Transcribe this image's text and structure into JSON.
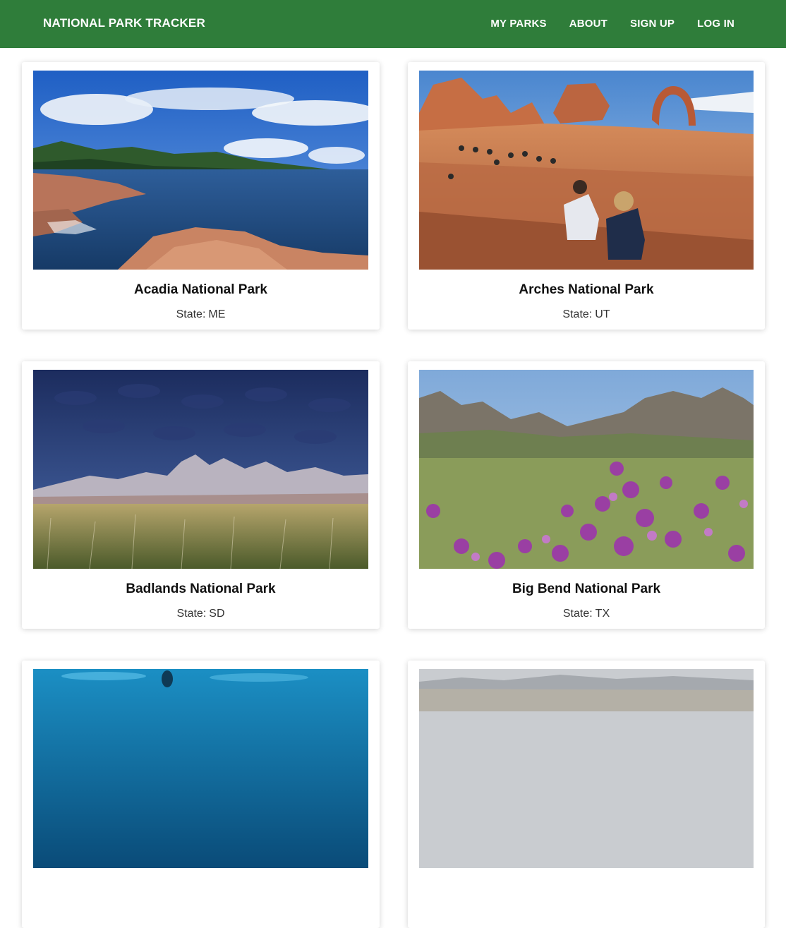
{
  "header": {
    "brand": "NATIONAL PARK TRACKER",
    "nav": [
      {
        "label": "MY PARKS"
      },
      {
        "label": "ABOUT"
      },
      {
        "label": "SIGN UP"
      },
      {
        "label": "LOG IN"
      }
    ]
  },
  "colors": {
    "nav_background": "#2f7d3a",
    "nav_text": "#ffffff"
  },
  "state_label": "State:",
  "parks": [
    {
      "name": "Acadia National Park",
      "state": "ME",
      "photo": "rocky-ocean-coast-photo"
    },
    {
      "name": "Arches National Park",
      "state": "UT",
      "photo": "desert-arch-hikers-photo"
    },
    {
      "name": "Badlands National Park",
      "state": "SD",
      "photo": "storm-badlands-grassland-photo"
    },
    {
      "name": "Big Bend National Park",
      "state": "TX",
      "photo": "purple-flowers-mountains-photo"
    },
    {
      "name": "",
      "state": "",
      "photo": "underwater-reef-photo"
    },
    {
      "name": "",
      "state": "",
      "photo": "hazy-mountain-valley-photo"
    }
  ]
}
